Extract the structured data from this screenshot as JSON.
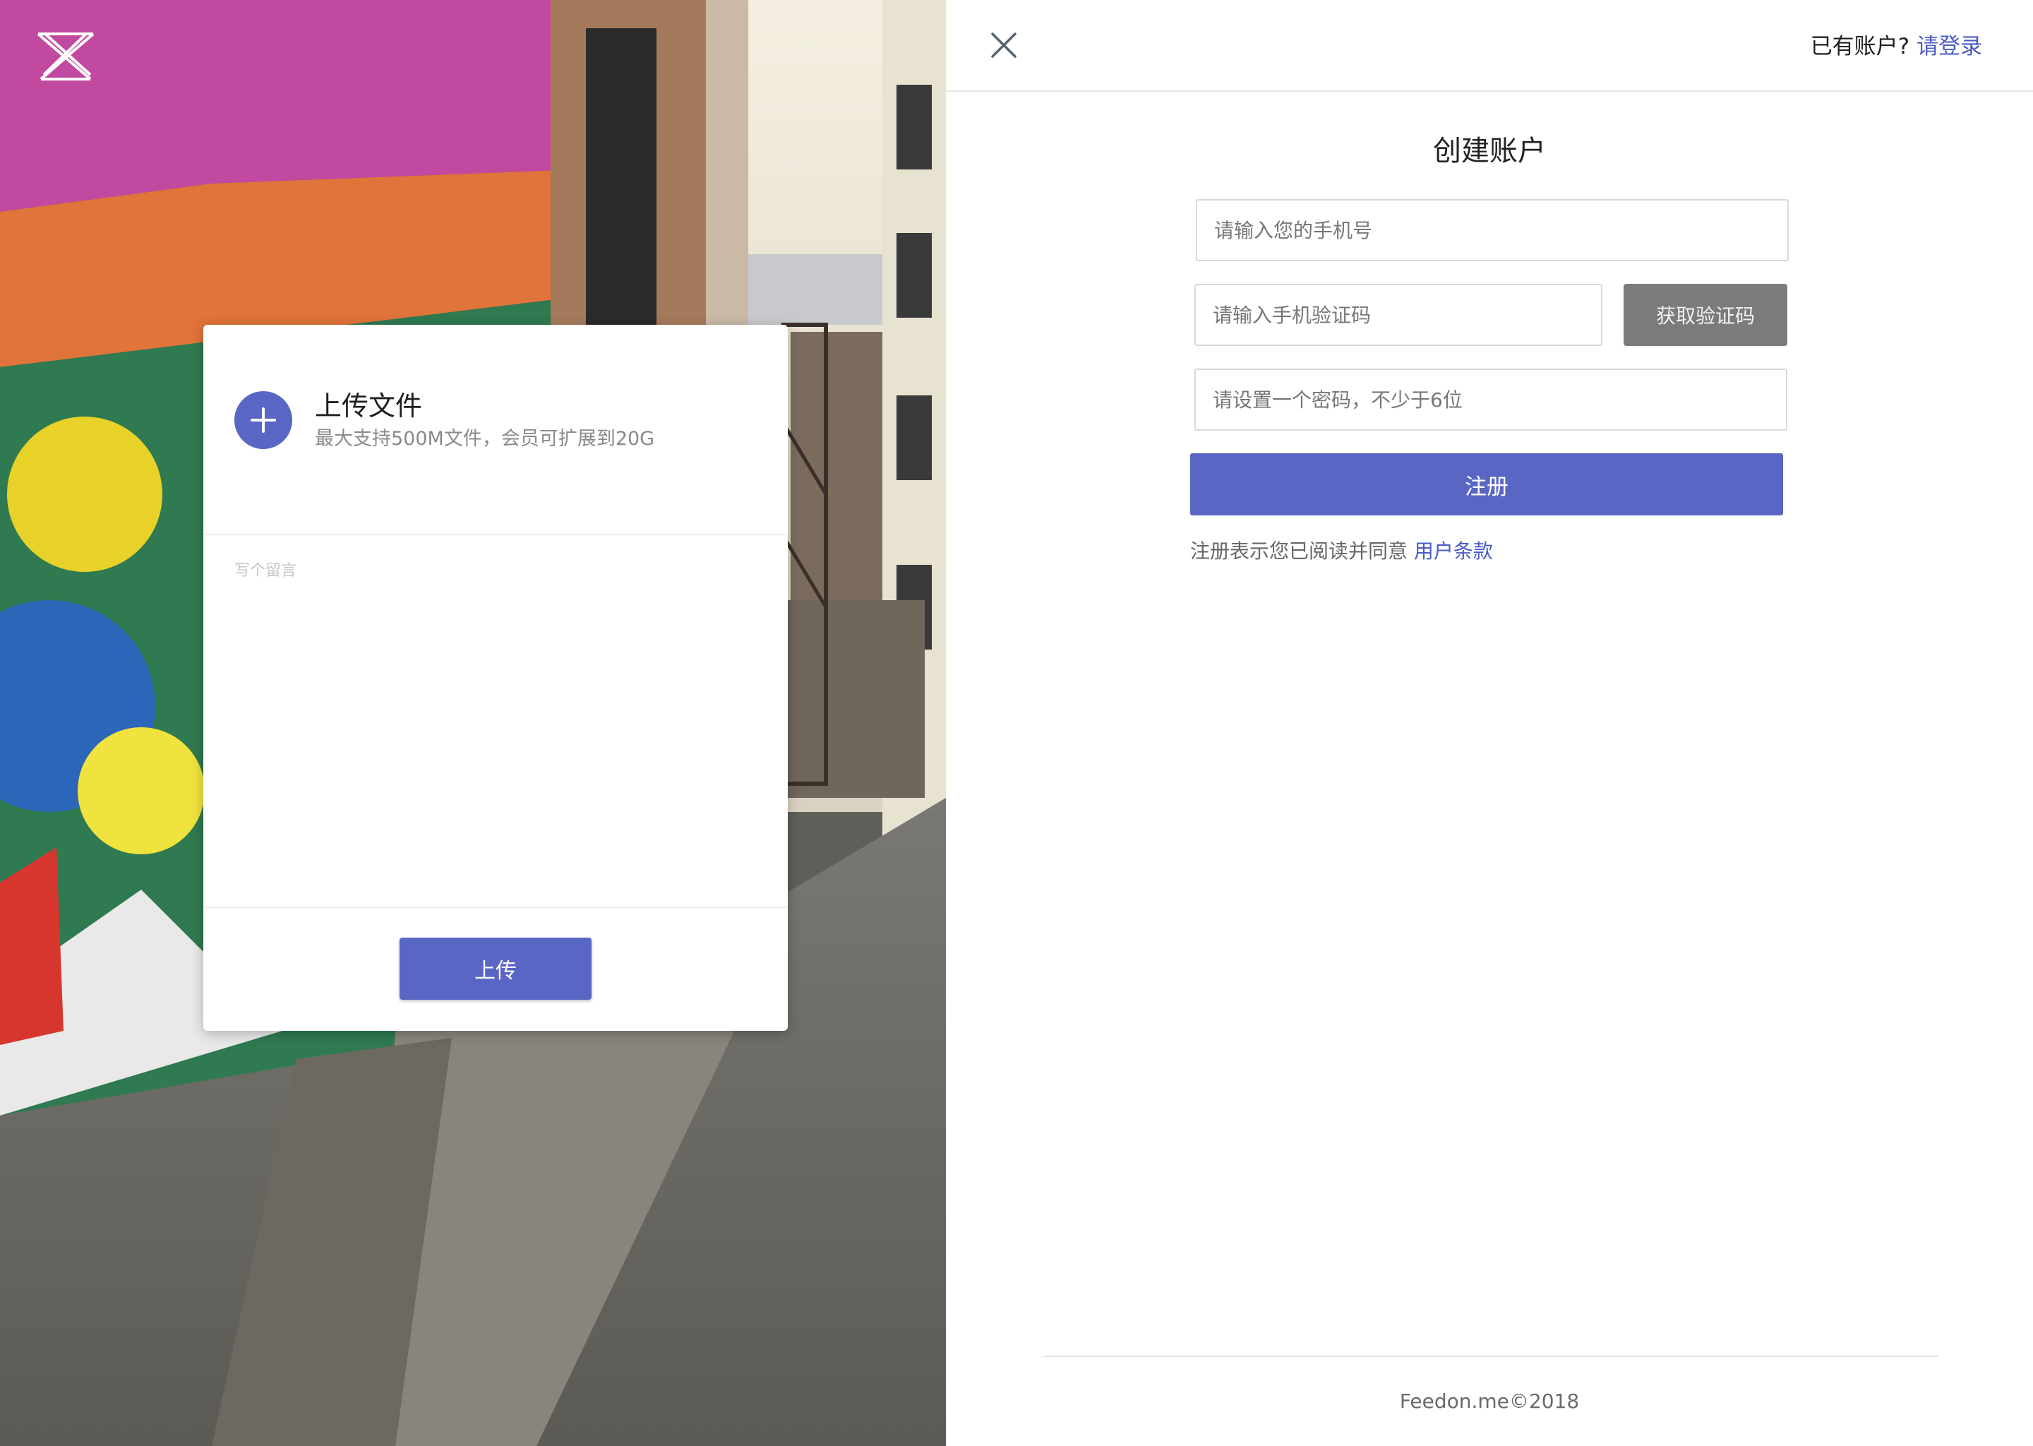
{
  "brand": {
    "logo_icon": "x-logo-icon"
  },
  "upload_card": {
    "title": "上传文件",
    "subtitle": "最大支持500M文件，会员可扩展到20G",
    "message_placeholder": "写个留言",
    "upload_button": "上传"
  },
  "auth": {
    "have_account_text": "已有账户?",
    "login_link": "请登录",
    "title": "创建账户",
    "phone_placeholder": "请输入您的手机号",
    "code_placeholder": "请输入手机验证码",
    "get_code_button": "获取验证码",
    "password_placeholder": "请设置一个密码，不少于6位",
    "register_button": "注册",
    "terms_prefix": "注册表示您已阅读并同意",
    "terms_link": "用户条款"
  },
  "footer": {
    "copyright": "Feedon.me©2018"
  },
  "colors": {
    "accent": "#5966c4",
    "link": "#4a5bc4",
    "code_button": "#7b7b7b"
  }
}
